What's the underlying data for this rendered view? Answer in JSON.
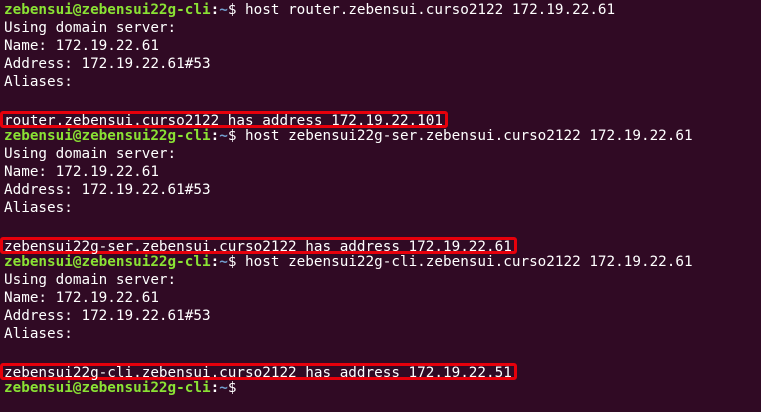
{
  "prompt": {
    "user_host": "zebensui@zebensui22g-cli",
    "colon": ":",
    "path": "~",
    "symbol": "$"
  },
  "blocks": [
    {
      "command": " host router.zebensui.curso2122 172.19.22.61",
      "server_line": "Using domain server:",
      "name_line": "Name: 172.19.22.61",
      "address_line": "Address: 172.19.22.61#53",
      "aliases_line": "Aliases:",
      "result": "router.zebensui.curso2122 has address 172.19.22.101"
    },
    {
      "command": " host zebensui22g-ser.zebensui.curso2122 172.19.22.61",
      "server_line": "Using domain server:",
      "name_line": "Name: 172.19.22.61",
      "address_line": "Address: 172.19.22.61#53",
      "aliases_line": "Aliases:",
      "result": "zebensui22g-ser.zebensui.curso2122 has address 172.19.22.61"
    },
    {
      "command": " host zebensui22g-cli.zebensui.curso2122 172.19.22.61",
      "server_line": "Using domain server:",
      "name_line": "Name: 172.19.22.61",
      "address_line": "Address: 172.19.22.61#53",
      "aliases_line": "Aliases:",
      "result": "zebensui22g-cli.zebensui.curso2122 has address 172.19.22.51"
    }
  ],
  "colors": {
    "background": "#300a24",
    "prompt_user": "#8ae234",
    "prompt_path": "#729fcf",
    "text": "#ffffff",
    "highlight_box": "#e6000b"
  }
}
